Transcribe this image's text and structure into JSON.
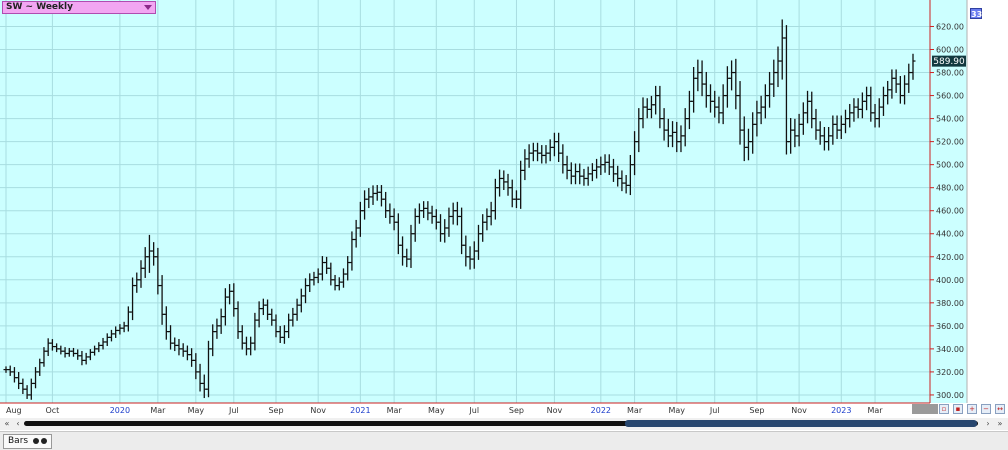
{
  "symbol_title": "SW ~ Weekly",
  "corner_badge": "33",
  "last_price": "589.90",
  "bottom_tab": "Bars",
  "scroll_left": "«",
  "scroll_prev": "‹",
  "scroll_next": "›",
  "scroll_right": "»",
  "toolbar_icons": [
    "chart-type-icon",
    "chart-type-icon",
    "zoom-in-icon",
    "zoom-out-icon",
    "fit-icon"
  ],
  "colors": {
    "plot_bg": "#ccffff",
    "grid": "#a8dde0",
    "bars": "#111111",
    "price_line": "#cc2222",
    "price_tag_bg": "#12393f",
    "year_label": "#1a3ccc"
  },
  "chart_data": {
    "type": "ohlc",
    "y_ticks": [
      300,
      320,
      340,
      360,
      380,
      400,
      420,
      440,
      460,
      480,
      500,
      520,
      540,
      560,
      580,
      600,
      620
    ],
    "y_tick_labels": [
      "300.00",
      "320.00",
      "340.00",
      "360.00",
      "380.00",
      "400.00",
      "420.00",
      "440.00",
      "460.00",
      "480.00",
      "500.00",
      "520.00",
      "540.00",
      "560.00",
      "580.00",
      "600.00",
      "620.00"
    ],
    "ylim": [
      293,
      643
    ],
    "x_labels": [
      {
        "text": "Aug",
        "i": 0,
        "year": false
      },
      {
        "text": "Oct",
        "i": 11,
        "year": false
      },
      {
        "text": "2020",
        "i": 27,
        "year": true
      },
      {
        "text": "Mar",
        "i": 36,
        "year": false
      },
      {
        "text": "May",
        "i": 45,
        "year": false
      },
      {
        "text": "Jul",
        "i": 54,
        "year": false
      },
      {
        "text": "Sep",
        "i": 64,
        "year": false
      },
      {
        "text": "Nov",
        "i": 74,
        "year": false
      },
      {
        "text": "2021",
        "i": 84,
        "year": true
      },
      {
        "text": "Mar",
        "i": 92,
        "year": false
      },
      {
        "text": "May",
        "i": 102,
        "year": false
      },
      {
        "text": "Jul",
        "i": 111,
        "year": false
      },
      {
        "text": "Sep",
        "i": 121,
        "year": false
      },
      {
        "text": "Nov",
        "i": 130,
        "year": false
      },
      {
        "text": "2022",
        "i": 141,
        "year": true
      },
      {
        "text": "Mar",
        "i": 149,
        "year": false
      },
      {
        "text": "May",
        "i": 159,
        "year": false
      },
      {
        "text": "Jul",
        "i": 168,
        "year": false
      },
      {
        "text": "Sep",
        "i": 178,
        "year": false
      },
      {
        "text": "Nov",
        "i": 188,
        "year": false
      },
      {
        "text": "2023",
        "i": 198,
        "year": true
      },
      {
        "text": "Mar",
        "i": 206,
        "year": false
      }
    ],
    "closes": [
      322,
      320,
      315,
      310,
      305,
      300,
      310,
      320,
      328,
      338,
      345,
      342,
      340,
      338,
      336,
      338,
      336,
      334,
      330,
      333,
      337,
      340,
      343,
      346,
      350,
      353,
      356,
      358,
      360,
      372,
      395,
      400,
      410,
      420,
      425,
      420,
      395,
      370,
      355,
      345,
      343,
      340,
      338,
      335,
      330,
      320,
      310,
      305,
      340,
      355,
      360,
      368,
      385,
      390,
      375,
      355,
      345,
      340,
      345,
      365,
      375,
      378,
      370,
      365,
      355,
      350,
      355,
      365,
      370,
      378,
      386,
      395,
      400,
      402,
      405,
      415,
      410,
      400,
      395,
      398,
      405,
      415,
      435,
      445,
      460,
      470,
      472,
      475,
      476,
      470,
      460,
      455,
      450,
      430,
      420,
      418,
      440,
      455,
      460,
      462,
      458,
      455,
      450,
      440,
      445,
      455,
      460,
      455,
      430,
      420,
      418,
      425,
      440,
      450,
      455,
      460,
      480,
      488,
      485,
      480,
      470,
      470,
      495,
      505,
      510,
      512,
      510,
      508,
      510,
      515,
      520,
      510,
      500,
      495,
      490,
      494,
      490,
      488,
      492,
      495,
      498,
      500,
      502,
      498,
      492,
      488,
      484,
      482,
      500,
      520,
      540,
      550,
      548,
      552,
      560,
      540,
      530,
      525,
      528,
      520,
      525,
      540,
      555,
      575,
      580,
      570,
      560,
      555,
      550,
      545,
      560,
      575,
      580,
      560,
      530,
      515,
      520,
      535,
      545,
      550,
      560,
      570,
      580,
      590,
      610,
      520,
      530,
      525,
      535,
      545,
      555,
      540,
      530,
      525,
      520,
      525,
      535,
      530,
      535,
      540,
      545,
      550,
      548,
      555,
      560,
      545,
      540,
      550,
      560,
      565,
      575,
      570,
      560,
      570,
      580,
      590
    ],
    "ranges": [
      8,
      10,
      12,
      14,
      12,
      10,
      12,
      12,
      10,
      10,
      12,
      10,
      8,
      8,
      10,
      8,
      8,
      10,
      12,
      10,
      8,
      8,
      8,
      10,
      10,
      10,
      10,
      10,
      10,
      14,
      20,
      18,
      20,
      24,
      40,
      22,
      22,
      26,
      20,
      16,
      14,
      16,
      14,
      14,
      16,
      18,
      20,
      22,
      20,
      18,
      18,
      20,
      22,
      18,
      20,
      18,
      16,
      16,
      16,
      18,
      18,
      16,
      14,
      14,
      14,
      14,
      16,
      16,
      16,
      16,
      18,
      18,
      16,
      14,
      14,
      16,
      14,
      14,
      12,
      12,
      14,
      16,
      20,
      20,
      22,
      22,
      22,
      20,
      18,
      18,
      18,
      18,
      20,
      22,
      22,
      20,
      22,
      20,
      18,
      18,
      18,
      18,
      18,
      20,
      22,
      22,
      20,
      22,
      22,
      24,
      26,
      24,
      22,
      20,
      20,
      22,
      22,
      22,
      20,
      20,
      20,
      22,
      24,
      24,
      22,
      20,
      20,
      20,
      20,
      20,
      22,
      22,
      22,
      22,
      20,
      20,
      20,
      18,
      18,
      18,
      20,
      20,
      20,
      20,
      20,
      20,
      20,
      20,
      24,
      26,
      26,
      24,
      22,
      22,
      24,
      24,
      26,
      28,
      28,
      26,
      26,
      26,
      26,
      28,
      32,
      30,
      30,
      28,
      26,
      26,
      28,
      30,
      30,
      34,
      36,
      34,
      32,
      30,
      30,
      28,
      28,
      30,
      32,
      36,
      46,
      32,
      30,
      28,
      26,
      26,
      26,
      24,
      24,
      22,
      22,
      22,
      22,
      22,
      22,
      22,
      22,
      22,
      22,
      22,
      22,
      22,
      22,
      22,
      22,
      22,
      22,
      22,
      20,
      22,
      22,
      18
    ]
  }
}
